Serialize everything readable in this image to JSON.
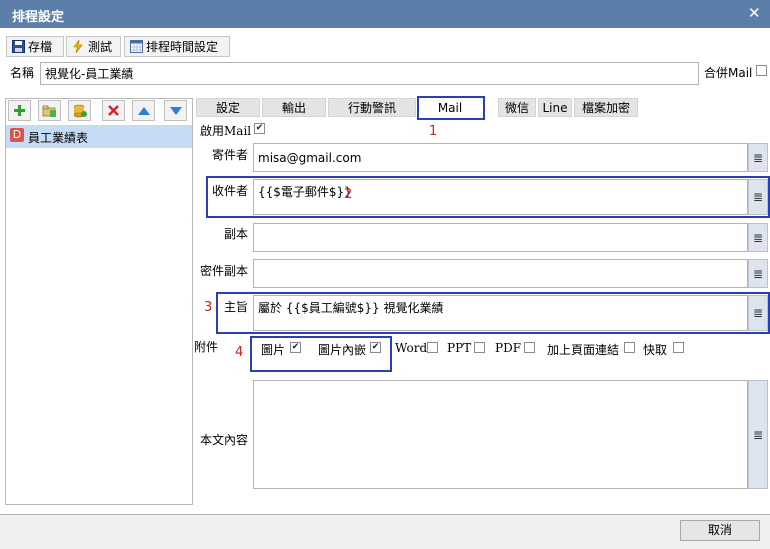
{
  "window": {
    "title": "排程設定"
  },
  "toolbar": {
    "save_label": "存檔",
    "test_label": "測試",
    "schedule_label": "排程時間設定"
  },
  "name_row": {
    "label": "名稱",
    "value": "視覺化-員工業績",
    "merge_mail_label": "合併Mail",
    "merge_mail_checked": false
  },
  "tree": {
    "items": [
      {
        "badge": "D",
        "label": "員工業績表",
        "selected": true
      }
    ]
  },
  "tabs": [
    {
      "label": "設定"
    },
    {
      "label": "輸出"
    },
    {
      "label": "行動警訊"
    },
    {
      "label": "Mail",
      "active": true
    },
    {
      "label": "微信"
    },
    {
      "label": "Line"
    },
    {
      "label": "檔案加密"
    }
  ],
  "mail": {
    "enable_label": "啟用Mail",
    "enable_checked": true,
    "sender_label": "寄件者",
    "sender_value": "misa@gmail.com",
    "recipient_label": "收件者",
    "recipient_value": "{{$電子郵件$}}",
    "cc_label": "副本",
    "cc_value": "",
    "bcc_label": "密件副本",
    "bcc_value": "",
    "subject_label": "主旨",
    "subject_value": "屬於 {{$員工編號$}} 視覺化業績",
    "attach_label": "附件",
    "attachments": [
      {
        "label": "圖片",
        "checked": true
      },
      {
        "label": "圖片內嵌",
        "checked": true
      },
      {
        "label": "Word",
        "checked": false
      },
      {
        "label": "PPT",
        "checked": false
      },
      {
        "label": "PDF",
        "checked": false
      },
      {
        "label": "加上頁面連結",
        "checked": false
      },
      {
        "label": "快取",
        "checked": false
      }
    ],
    "body_label": "本文內容",
    "body_value": ""
  },
  "annotations": {
    "n1": "1",
    "n2": "2",
    "n3": "3",
    "n4": "4"
  },
  "footer": {
    "cancel_label": "取消"
  },
  "colors": {
    "titlebar": "#5b7fa8",
    "highlight_box": "#2b3fb5",
    "annotation": "#d02020",
    "selected_row": "#c6dbf5"
  }
}
